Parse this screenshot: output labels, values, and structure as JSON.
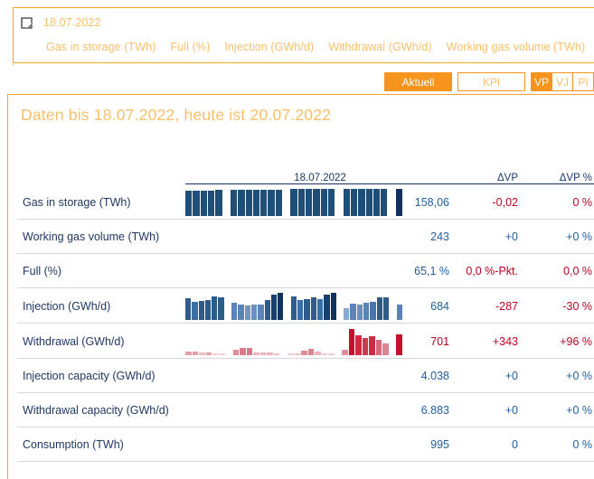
{
  "header": {
    "icon": "corner-bracket-icon",
    "date": "18.07.2022",
    "links": [
      "Gas in storage (TWh)",
      "Full (%)",
      "Injection (GWh/d)",
      "Withdrawal (GWh/d)",
      "Working gas volume (TWh)"
    ]
  },
  "buttons": {
    "aktuell": "Aktuell",
    "kpi": "KPI",
    "vp": "VP",
    "vj": "VJ",
    "pi": "PI"
  },
  "main": {
    "title": "Daten bis 18.07.2022, heute ist 20.07.2022"
  },
  "table": {
    "headers": {
      "label": "",
      "spark_date": "18.07.2022",
      "value": "",
      "dvp": "ΔVP",
      "dvp_pct": "ΔVP %"
    },
    "rows": [
      {
        "label": "Gas in storage (TWh)",
        "value": "158,06",
        "value_color": "blue",
        "dvp": "-0,02",
        "dvp_color": "red",
        "dvp_pct": "0 %",
        "dvp_pct_color": "red",
        "has_spark": true
      },
      {
        "label": "Working gas volume (TWh)",
        "value": "243",
        "value_color": "blue",
        "dvp": "+0",
        "dvp_color": "blue",
        "dvp_pct": "+0 %",
        "dvp_pct_color": "blue",
        "has_spark": false
      },
      {
        "label": "Full (%)",
        "value": "65,1 %",
        "value_color": "blue",
        "dvp": "0,0 %-Pkt.",
        "dvp_color": "red",
        "dvp_pct": "0,0 %",
        "dvp_pct_color": "red",
        "has_spark": false
      },
      {
        "label": "Injection (GWh/d)",
        "value": "684",
        "value_color": "blue",
        "dvp": "-287",
        "dvp_color": "red",
        "dvp_pct": "-30 %",
        "dvp_pct_color": "red",
        "has_spark": true
      },
      {
        "label": "Withdrawal (GWh/d)",
        "value": "701",
        "value_color": "red",
        "dvp": "+343",
        "dvp_color": "red",
        "dvp_pct": "+96 %",
        "dvp_pct_color": "red",
        "has_spark": true
      },
      {
        "label": "Injection capacity (GWh/d)",
        "value": "4.038",
        "value_color": "blue",
        "dvp": "+0",
        "dvp_color": "blue",
        "dvp_pct": "+0 %",
        "dvp_pct_color": "blue",
        "has_spark": false
      },
      {
        "label": "Withdrawal capacity (GWh/d)",
        "value": "6.883",
        "value_color": "blue",
        "dvp": "+0",
        "dvp_color": "blue",
        "dvp_pct": "+0 %",
        "dvp_pct_color": "blue",
        "has_spark": false
      },
      {
        "label": "Consumption (TWh)",
        "value": "995",
        "value_color": "blue",
        "dvp": "0",
        "dvp_color": "blue",
        "dvp_pct": "0 %",
        "dvp_pct_color": "blue",
        "has_spark": false
      }
    ]
  },
  "chart_data": [
    {
      "type": "bar",
      "name": "gas-in-storage-sparkline",
      "title": "Gas in storage (TWh)",
      "xlabel": "",
      "ylabel": "TWh",
      "ylim": [
        0,
        1
      ],
      "last_value": "158,06",
      "values": [
        0.92,
        0.92,
        0.92,
        0.92,
        0.95,
        0,
        0.95,
        0.95,
        0.95,
        0.95,
        0.95,
        0.95,
        0.98,
        0,
        1.0,
        1.0,
        1.0,
        1.0,
        1.0,
        1.0,
        0,
        1.0,
        1.0,
        1.0,
        1.0,
        1.0,
        1.0,
        0,
        1.0
      ],
      "colors": [
        "#1f4e79",
        "#1f4e79",
        "#1f4e79",
        "#1f4e79",
        "#1f4e79",
        null,
        "#1f4e79",
        "#1f4e79",
        "#1f4e79",
        "#1f4e79",
        "#1f4e79",
        "#1f4e79",
        "#1f4e79",
        null,
        "#1f4e79",
        "#1f4e79",
        "#1f4e79",
        "#1f4e79",
        "#1f4e79",
        "#1f4e79",
        null,
        "#1f4e79",
        "#1f4e79",
        "#1f4e79",
        "#1f4e79",
        "#1f4e79",
        "#1f4e79",
        null,
        "#10325c"
      ]
    },
    {
      "type": "bar",
      "name": "injection-sparkline",
      "title": "Injection (GWh/d)",
      "xlabel": "",
      "ylabel": "GWh/d",
      "ylim": [
        0,
        1
      ],
      "last_value": "684",
      "values": [
        0.8,
        0.66,
        0.7,
        0.72,
        0.88,
        0.82,
        0,
        0.62,
        0.56,
        0.52,
        0.55,
        0.58,
        0.72,
        0.92,
        1.0,
        0,
        0.85,
        0.72,
        0.78,
        0.84,
        0.78,
        0.92,
        1.0,
        0,
        0.44,
        0.6,
        0.56,
        0.64,
        0.66,
        0.82,
        0.82,
        0,
        0.58
      ],
      "colors": [
        "#2e5c8a",
        "#3b6ea5",
        "#2e5c8a",
        "#2e5c8a",
        "#2e5c8a",
        "#2e5c8a",
        null,
        "#5b83b5",
        "#5b83b5",
        "#7296c2",
        "#6a8fbd",
        "#5b83b5",
        "#2e5c8a",
        "#18406e",
        "#10325c",
        null,
        "#2e5c8a",
        "#3b6ea5",
        "#2e5c8a",
        "#2e5c8a",
        "#3b6ea5",
        "#18406e",
        "#10325c",
        null,
        "#89a8cd",
        "#5b83b5",
        "#6a8fbd",
        "#5b83b5",
        "#4a76ae",
        "#2e5c8a",
        "#2e5c8a",
        null,
        "#5b83b5"
      ]
    },
    {
      "type": "bar",
      "name": "withdrawal-sparkline",
      "title": "Withdrawal (GWh/d)",
      "xlabel": "",
      "ylabel": "GWh/d",
      "ylim": [
        0,
        1
      ],
      "last_value": "701",
      "values": [
        0.14,
        0.13,
        0.09,
        0.1,
        0.05,
        0.03,
        0,
        0.2,
        0.28,
        0.26,
        0.09,
        0.09,
        0.09,
        0.08,
        0,
        0.05,
        0.06,
        0.16,
        0.22,
        0.12,
        0.05,
        0.05,
        0,
        0.2,
        0.95,
        0.72,
        0.62,
        0.7,
        0.55,
        0.42,
        0,
        0.78
      ],
      "colors": [
        "#e8a0ab",
        "#e8a0ab",
        "#f0bcc4",
        "#e8a0ab",
        "#f3ccd2",
        "#f3ccd2",
        null,
        "#e08e9c",
        "#d9798a",
        "#d9798a",
        "#edb2bb",
        "#edb2bb",
        "#edb2bb",
        "#f0bcc4",
        null,
        "#f3ccd2",
        "#f0bcc4",
        "#e08e9c",
        "#dd8492",
        "#edb2bb",
        "#f3ccd2",
        "#f3ccd2",
        null,
        "#e08e9c",
        "#c8102e",
        "#cc2b43",
        "#cc3a50",
        "#cc2b43",
        "#d9687c",
        "#dd8492",
        null,
        "#c8102e"
      ]
    }
  ]
}
